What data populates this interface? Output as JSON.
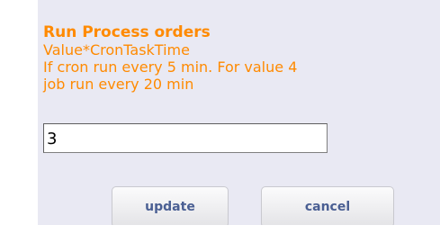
{
  "form": {
    "title": "Run Process orders",
    "lines": [
      "Value*CronTaskTime",
      "If cron run every 5 min. For value 4",
      "job run every 20 min"
    ],
    "input_value": "3"
  },
  "buttons": {
    "update_label": "update",
    "cancel_label": "cancel"
  },
  "colors": {
    "accent_orange": "#ff8a00",
    "button_text": "#4a5f93",
    "panel_background": "#e9e9f3"
  }
}
